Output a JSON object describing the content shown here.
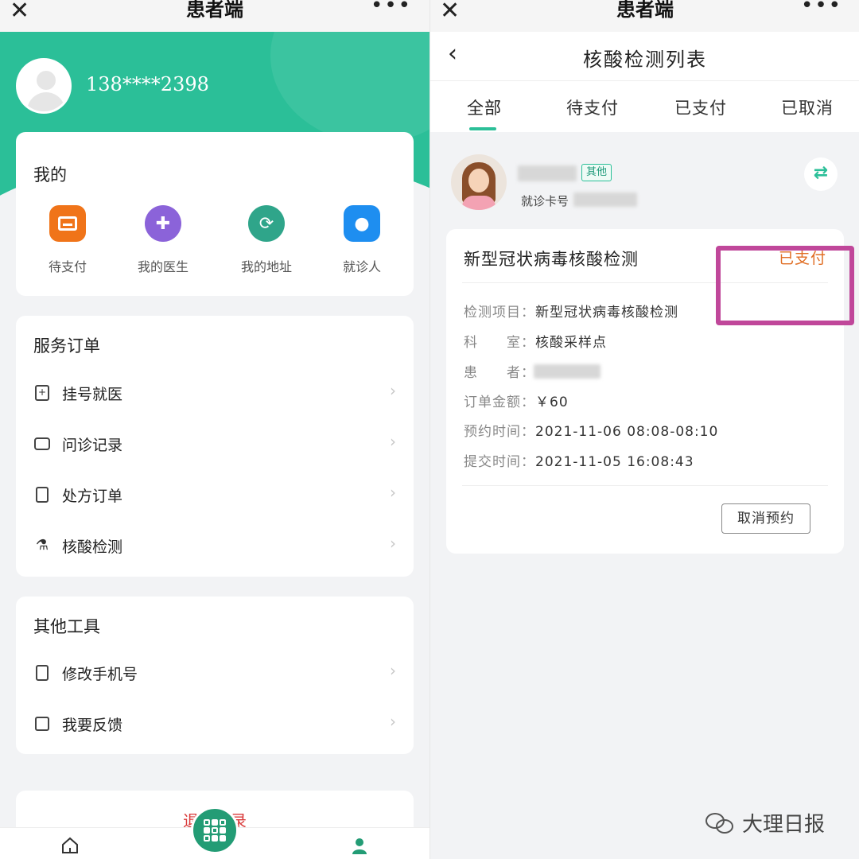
{
  "left": {
    "window_title": "患者端",
    "phone": "138****2398",
    "mine": {
      "title": "我的",
      "shortcuts": [
        {
          "label": "待支付",
          "icon": "wallet-icon",
          "color": "#f07419"
        },
        {
          "label": "我的医生",
          "icon": "nurse-icon",
          "color": "#8b63d9"
        },
        {
          "label": "我的地址",
          "icon": "location-icon",
          "color": "#2fa58a"
        },
        {
          "label": "就诊人",
          "icon": "person-icon",
          "color": "#1e8ef0"
        }
      ]
    },
    "service": {
      "title": "服务订单",
      "items": [
        {
          "label": "挂号就医",
          "icon": "register-icon"
        },
        {
          "label": "问诊记录",
          "icon": "chat-icon"
        },
        {
          "label": "处方订单",
          "icon": "clipboard-icon"
        },
        {
          "label": "核酸检测",
          "icon": "flask-icon"
        }
      ]
    },
    "tools": {
      "title": "其他工具",
      "items": [
        {
          "label": "修改手机号",
          "icon": "phone-icon"
        },
        {
          "label": "我要反馈",
          "icon": "edit-icon"
        }
      ]
    },
    "logout_label": "退出登录"
  },
  "right": {
    "window_title": "患者端",
    "page_title": "核酸检测列表",
    "tabs": [
      "全部",
      "待支付",
      "已支付",
      "已取消"
    ],
    "active_tab": "全部",
    "patient": {
      "tag": "其他",
      "card_label": "就诊卡号"
    },
    "order": {
      "name": "新型冠状病毒核酸检测",
      "status": "已支付",
      "fields": [
        {
          "key": "检测项目：",
          "value": "新型冠状病毒核酸检测"
        },
        {
          "key": "科　　室：",
          "value": "核酸采样点"
        },
        {
          "key": "患　　者：",
          "value": ""
        },
        {
          "key": "订单金额：",
          "value": "￥60"
        },
        {
          "key": "预约时间：",
          "value": "2021-11-06  08:08-08:10"
        },
        {
          "key": "提交时间：",
          "value": "2021-11-05  16:08:43"
        }
      ],
      "cancel_label": "取消预约"
    }
  },
  "watermark": "大理日报",
  "colors": {
    "brand": "#2bbf98",
    "status_paid": "#e06d23",
    "highlight": "#c0479a",
    "logout": "#d93b3b"
  }
}
